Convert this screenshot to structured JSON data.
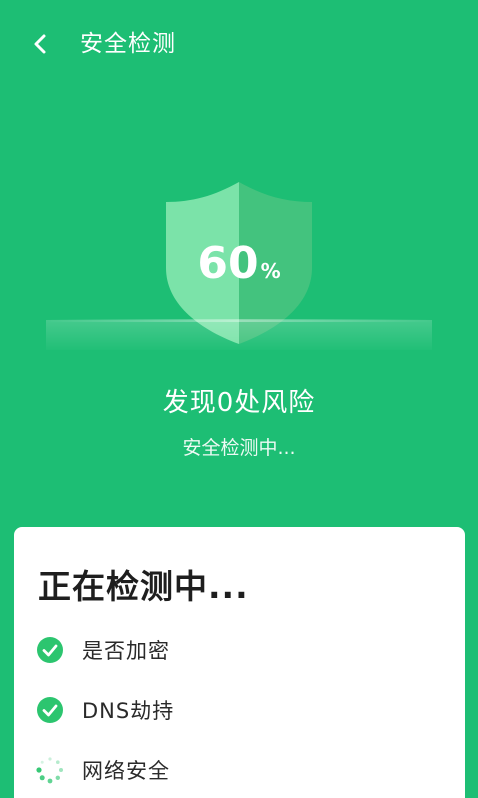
{
  "header": {
    "title": "安全检测",
    "back_icon": "chevron-left-icon"
  },
  "scan": {
    "progress_value": "60",
    "progress_unit": "%",
    "progress_fraction": 0.6,
    "headline": "发现0处风险",
    "status": "安全检测中..."
  },
  "card": {
    "title": "正在检测中...",
    "items": [
      {
        "label": "是否加密",
        "state": "done",
        "icon": "check-circle-icon"
      },
      {
        "label": "DNS劫持",
        "state": "done",
        "icon": "check-circle-icon"
      },
      {
        "label": "网络安全",
        "state": "loading",
        "icon": "spinner-icon"
      }
    ]
  },
  "colors": {
    "background": "#1DBE74",
    "check": "#2CC56F",
    "card": "#FFFFFF"
  }
}
